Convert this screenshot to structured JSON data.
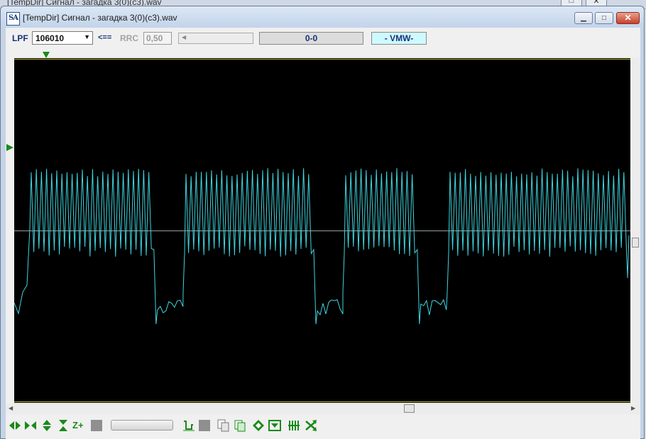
{
  "background_window": {
    "title": "[TempDir] Сигнал - загадка 3(0)(c3).wav"
  },
  "window": {
    "app_icon_text": "SA",
    "title": "[TempDir] Сигнал - загадка 3(0)(c3).wav"
  },
  "toolbar": {
    "lpf_label": "LPF",
    "lpf_value": "106010",
    "arrow_label": "<==",
    "rrc_label": "RRC",
    "rrc_value": "0,50",
    "position_readout": "0-0",
    "mode_badge": "- VMW-"
  },
  "colors": {
    "plot_background": "#000000",
    "waveform": "#3fd6e0",
    "baseline": "#9aa0a0",
    "marker": "#1a8a1a",
    "icon_green": "#1a8a1a"
  },
  "bottom_toolbar": {
    "zoom_plus_label": "Z+",
    "icons": [
      "pan-left-right-icon",
      "zoom-in-horizontal-icon",
      "pan-up-down-icon",
      "zoom-vertical-icon",
      "zoom-plus-icon",
      "stop-icon",
      "zoom-slider",
      "cut-icon",
      "gray-square-icon",
      "copy-icon",
      "paste-icon",
      "diamond-icon",
      "fit-icon",
      "grid-icon",
      "shuffle-icon"
    ]
  }
}
